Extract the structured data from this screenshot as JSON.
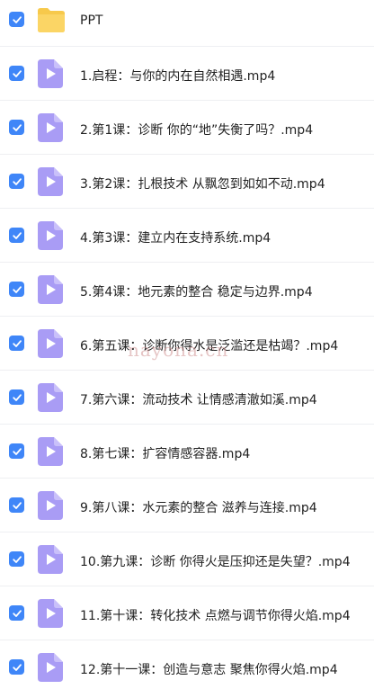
{
  "colors": {
    "checkbox": "#3f86f8",
    "video_icon": "#a99cf5",
    "folder_icon": "#f7c94b"
  },
  "items": [
    {
      "name": "PPT",
      "type": "folder",
      "checked": true
    },
    {
      "name": "1.启程：与你的内在自然相遇.mp4",
      "type": "video",
      "checked": true
    },
    {
      "name": "2.第1课：诊断 你的“地”失衡了吗？.mp4",
      "type": "video",
      "checked": true
    },
    {
      "name": "3.第2课：扎根技术 从飘忽到如如不动.mp4",
      "type": "video",
      "checked": true
    },
    {
      "name": "4.第3课：建立内在支持系统.mp4",
      "type": "video",
      "checked": true
    },
    {
      "name": "5.第4课：地元素的整合 稳定与边界.mp4",
      "type": "video",
      "checked": true
    },
    {
      "name": "6.第五课：诊断你得水是泛滥还是枯竭？.mp4",
      "type": "video",
      "checked": true
    },
    {
      "name": "7.第六课：流动技术 让情感清澈如溪.mp4",
      "type": "video",
      "checked": true
    },
    {
      "name": "8.第七课：扩容情感容器.mp4",
      "type": "video",
      "checked": true
    },
    {
      "name": "9.第八课：水元素的整合 滋养与连接.mp4",
      "type": "video",
      "checked": true
    },
    {
      "name": "10.第九课：诊断 你得火是压抑还是失望？.mp4",
      "type": "video",
      "checked": true
    },
    {
      "name": "11.第十课：转化技术 点燃与调节你得火焰.mp4",
      "type": "video",
      "checked": true
    },
    {
      "name": "12.第十一课：创造与意志 聚焦你得火焰.mp4",
      "type": "video",
      "checked": true
    }
  ],
  "watermark": "nayona.cn"
}
